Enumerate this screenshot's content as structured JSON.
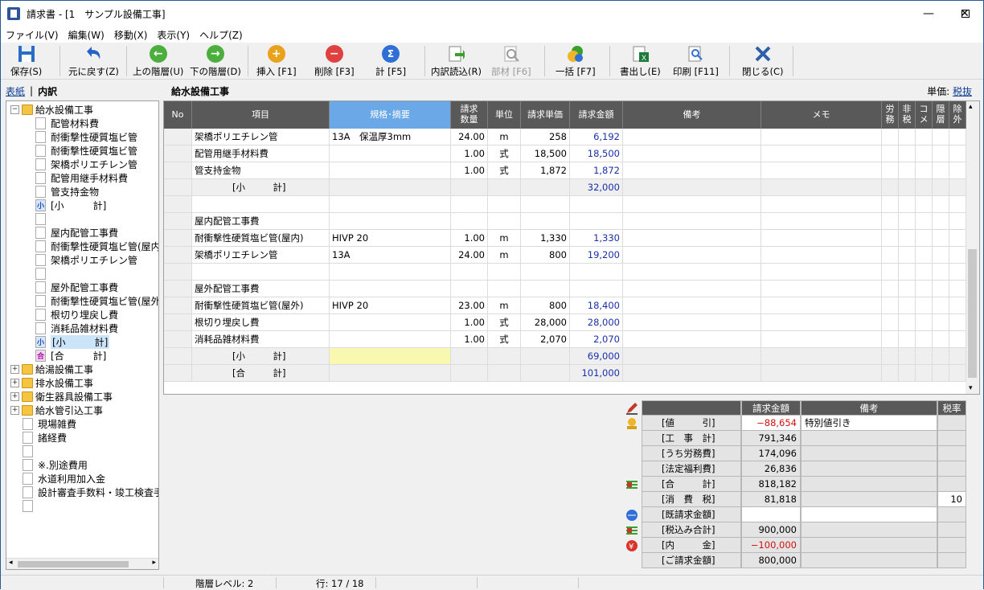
{
  "window": {
    "title": "請求書 - [1　サンプル設備工事]"
  },
  "menu": [
    "ファイル(V)",
    "編集(W)",
    "移動(X)",
    "表示(Y)",
    "ヘルプ(Z)"
  ],
  "toolbar": {
    "save": "保存(S)",
    "undo": "元に戻す(Z)",
    "up": "上の階層(U)",
    "down": "下の階層(D)",
    "insert": "挿入 [F1]",
    "delete": "削除 [F3]",
    "total": "計 [F5]",
    "import": "内訳読込(R)",
    "parts": "部材 [F6]",
    "bulk": "一括 [F7]",
    "export": "書出し(E)",
    "print": "印刷 [F11]",
    "close": "閉じる(C)"
  },
  "left": {
    "tab_cover": "表紙",
    "tab_sep": "|",
    "tab_detail": "内訳"
  },
  "tree": [
    {
      "label": "給水設備工事",
      "kind": "folder",
      "exp": "−",
      "lvl": 0
    },
    {
      "label": "配管材料費",
      "kind": "leaf",
      "lvl": 1
    },
    {
      "label": "耐衝撃性硬質塩ビ管",
      "kind": "leaf",
      "lvl": 1
    },
    {
      "label": "耐衝撃性硬質塩ビ管",
      "kind": "leaf",
      "lvl": 1
    },
    {
      "label": "架橋ポリエチレン管",
      "kind": "leaf",
      "lvl": 1
    },
    {
      "label": "配管用継手材料費",
      "kind": "leaf",
      "lvl": 1
    },
    {
      "label": "管支持金物",
      "kind": "leaf",
      "lvl": 1
    },
    {
      "label": "[小　　　計]",
      "kind": "sub",
      "badge": "小",
      "lvl": 1
    },
    {
      "label": "",
      "kind": "leaf",
      "lvl": 1
    },
    {
      "label": "屋内配管工事費",
      "kind": "leaf",
      "lvl": 1
    },
    {
      "label": "耐衝撃性硬質塩ビ管(屋内",
      "kind": "leaf",
      "lvl": 1
    },
    {
      "label": "架橋ポリエチレン管",
      "kind": "leaf",
      "lvl": 1
    },
    {
      "label": "",
      "kind": "leaf",
      "lvl": 1
    },
    {
      "label": "屋外配管工事費",
      "kind": "leaf",
      "lvl": 1
    },
    {
      "label": "耐衝撃性硬質塩ビ管(屋外",
      "kind": "leaf",
      "lvl": 1
    },
    {
      "label": "根切り埋戻し費",
      "kind": "leaf",
      "lvl": 1
    },
    {
      "label": "消耗品雑材料費",
      "kind": "leaf",
      "lvl": 1
    },
    {
      "label": "[小　　　計]",
      "kind": "sub",
      "badge": "小",
      "lvl": 1,
      "selected": true
    },
    {
      "label": "[合　　　計]",
      "kind": "total",
      "badge": "合",
      "lvl": 1
    },
    {
      "label": "給湯設備工事",
      "kind": "folder",
      "exp": "+",
      "lvl": 0
    },
    {
      "label": "排水設備工事",
      "kind": "folder",
      "exp": "+",
      "lvl": 0
    },
    {
      "label": "衛生器具設備工事",
      "kind": "folder",
      "exp": "+",
      "lvl": 0
    },
    {
      "label": "給水管引込工事",
      "kind": "folder",
      "exp": "+",
      "lvl": 0
    },
    {
      "label": "現場雑費",
      "kind": "leaf",
      "lvl": 0
    },
    {
      "label": "諸経費",
      "kind": "leaf",
      "lvl": 0
    },
    {
      "label": "",
      "kind": "leaf",
      "lvl": 0
    },
    {
      "label": "※.別途費用",
      "kind": "leaf",
      "lvl": 0
    },
    {
      "label": "水道利用加入金",
      "kind": "leaf",
      "lvl": 0
    },
    {
      "label": "設計審査手数料・竣工検査手",
      "kind": "leaf",
      "lvl": 0
    },
    {
      "label": "",
      "kind": "leaf",
      "lvl": 0
    }
  ],
  "section_title": "給水設備工事",
  "unit": {
    "label": "単価:",
    "value": "税抜"
  },
  "grid": {
    "headers": [
      "No",
      "項目",
      "規格･摘要",
      "請求\n数量",
      "単位",
      "請求単価",
      "請求金額",
      "備考",
      "メモ",
      "労\n務",
      "非\n税",
      "コ\nメ",
      "隠\n層",
      "除\n外"
    ],
    "rows": [
      {
        "item": "架橋ポリエチレン管",
        "spec": "13A　保温厚3mm",
        "qty": "24.00",
        "unit": "m",
        "price": "258",
        "amount": "6,192"
      },
      {
        "item": "配管用継手材料費",
        "spec": "",
        "qty": "1.00",
        "unit": "式",
        "price": "18,500",
        "amount": "18,500"
      },
      {
        "item": "管支持金物",
        "spec": "",
        "qty": "1.00",
        "unit": "式",
        "price": "1,872",
        "amount": "1,872"
      },
      {
        "item": "[小　　　計]",
        "spec": "",
        "qty": "",
        "unit": "",
        "price": "",
        "amount": "32,000",
        "sub": true
      },
      {
        "item": "",
        "spec": "",
        "qty": "",
        "unit": "",
        "price": "",
        "amount": ""
      },
      {
        "item": "屋内配管工事費",
        "spec": "",
        "qty": "",
        "unit": "",
        "price": "",
        "amount": ""
      },
      {
        "item": "耐衝撃性硬質塩ビ管(屋内)",
        "spec": "HIVP 20",
        "qty": "1.00",
        "unit": "m",
        "price": "1,330",
        "amount": "1,330"
      },
      {
        "item": "架橋ポリエチレン管",
        "spec": "13A",
        "qty": "24.00",
        "unit": "m",
        "price": "800",
        "amount": "19,200"
      },
      {
        "item": "",
        "spec": "",
        "qty": "",
        "unit": "",
        "price": "",
        "amount": ""
      },
      {
        "item": "屋外配管工事費",
        "spec": "",
        "qty": "",
        "unit": "",
        "price": "",
        "amount": ""
      },
      {
        "item": "耐衝撃性硬質塩ビ管(屋外)",
        "spec": "HIVP 20",
        "qty": "23.00",
        "unit": "m",
        "price": "800",
        "amount": "18,400"
      },
      {
        "item": "根切り埋戻し費",
        "spec": "",
        "qty": "1.00",
        "unit": "式",
        "price": "28,000",
        "amount": "28,000"
      },
      {
        "item": "消耗品雑材料費",
        "spec": "",
        "qty": "1.00",
        "unit": "式",
        "price": "2,070",
        "amount": "2,070"
      },
      {
        "item": "[小　　　計]",
        "spec": "",
        "qty": "",
        "unit": "",
        "price": "",
        "amount": "69,000",
        "sub": true,
        "selected": true
      },
      {
        "item": "[合　　　計]",
        "spec": "",
        "qty": "",
        "unit": "",
        "price": "",
        "amount": "101,000",
        "sub": true
      }
    ]
  },
  "summary": {
    "headers": [
      "請求金額",
      "備考",
      "税率"
    ],
    "rows": [
      {
        "label": "[値　　　引]",
        "amount": "−88,654",
        "note": "特別値引き",
        "rate": "",
        "red": true,
        "white": true
      },
      {
        "label": "[工　事　計]",
        "amount": "791,346",
        "note": "",
        "rate": ""
      },
      {
        "label": "[うち労務費]",
        "amount": "174,096",
        "note": "",
        "rate": ""
      },
      {
        "label": "[法定福利費]",
        "amount": "26,836",
        "note": "",
        "rate": ""
      },
      {
        "label": "[合　　　計]",
        "amount": "818,182",
        "note": "",
        "rate": ""
      },
      {
        "label": "[消　費　税]",
        "amount": "81,818",
        "note": "",
        "rate": "10",
        "ratewhite": true
      },
      {
        "label": "[既請求金額]",
        "amount": "",
        "note": "",
        "rate": "",
        "white": true
      },
      {
        "label": "[税込み合計]",
        "amount": "900,000",
        "note": "",
        "rate": ""
      },
      {
        "label": "[内　　　金]",
        "amount": "−100,000",
        "note": "",
        "rate": "",
        "red": true
      },
      {
        "label": "[ご請求金額]",
        "amount": "800,000",
        "note": "",
        "rate": ""
      }
    ]
  },
  "status": {
    "level": "階層レベル: 2",
    "row": "行:  17 / 18"
  }
}
